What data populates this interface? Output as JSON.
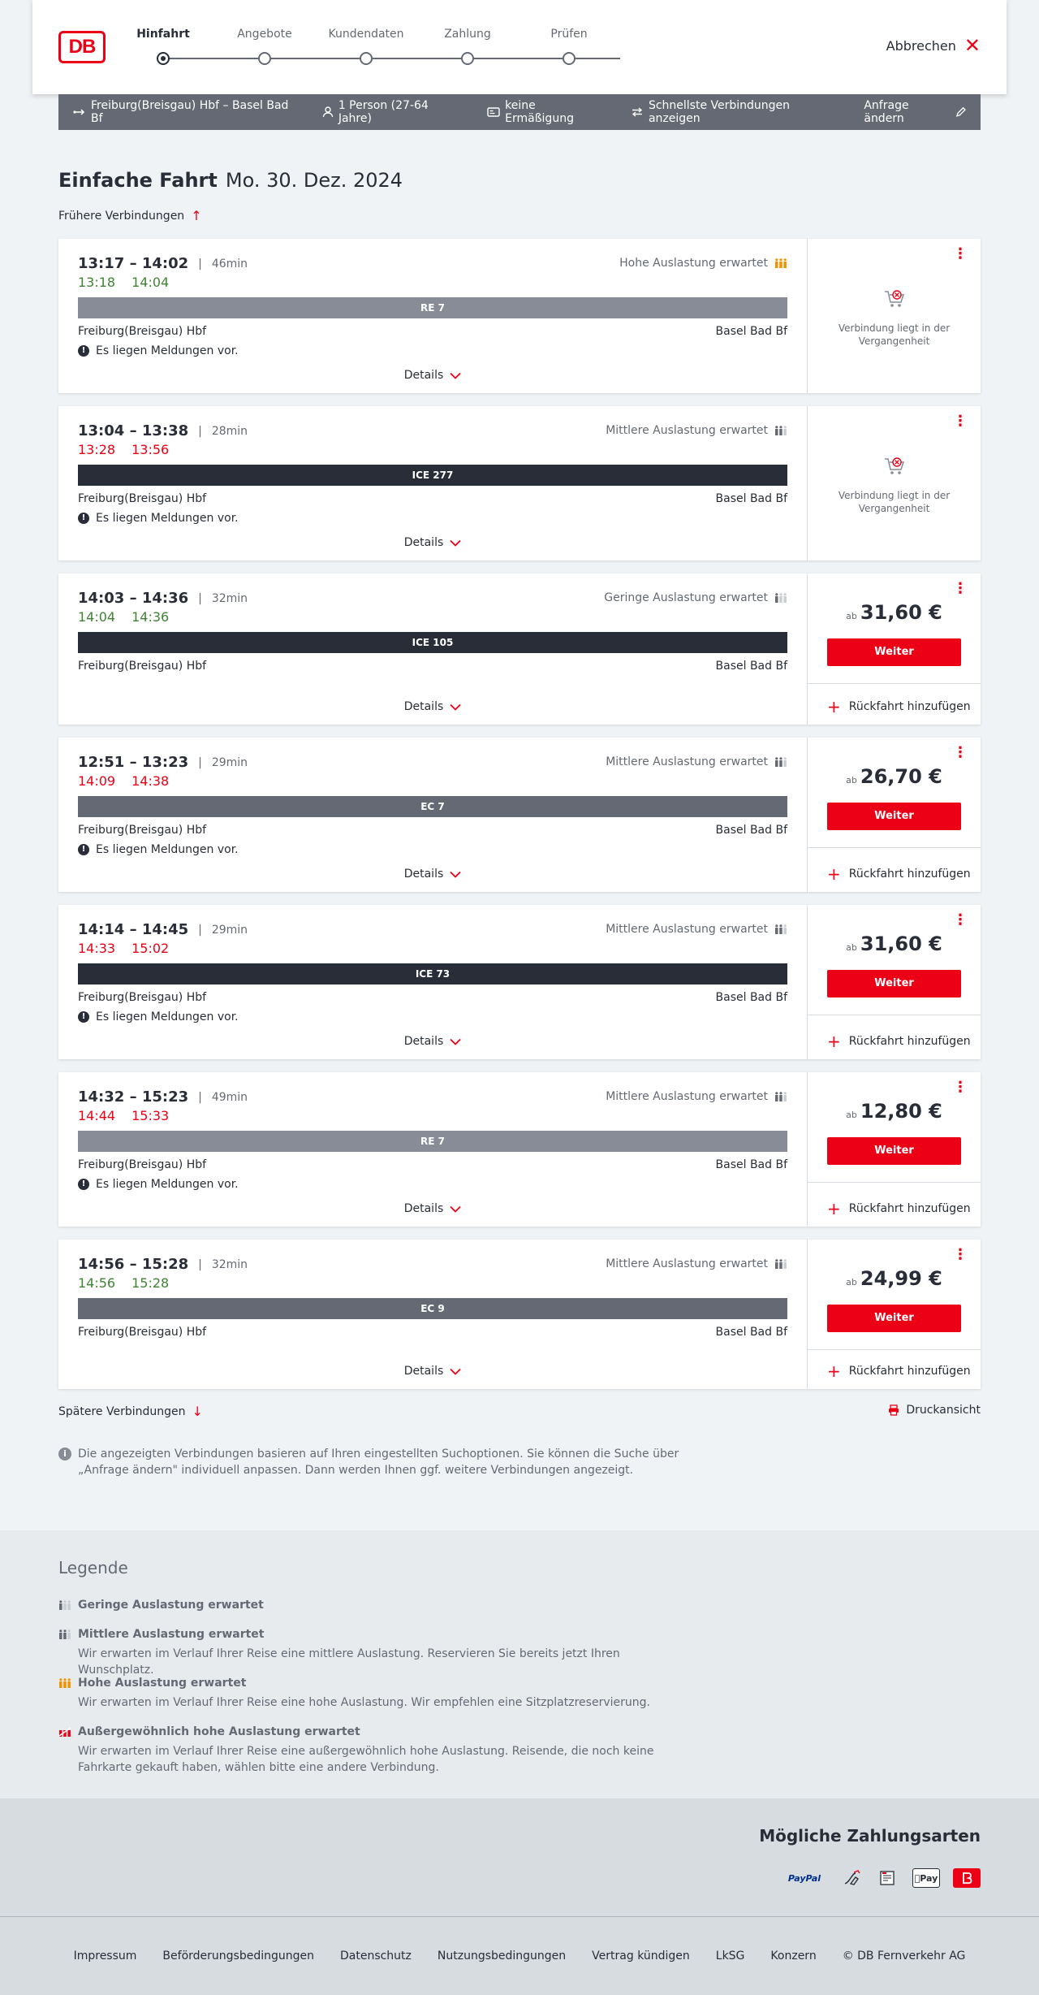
{
  "header": {
    "logo_text": "DB",
    "steps": [
      {
        "label": "Hinfahrt",
        "active": true
      },
      {
        "label": "Angebote",
        "active": false
      },
      {
        "label": "Kundendaten",
        "active": false
      },
      {
        "label": "Zahlung",
        "active": false
      },
      {
        "label": "Prüfen",
        "active": false
      }
    ],
    "cancel_label": "Abbrechen"
  },
  "search": {
    "route": "Freiburg(Breisgau) Hbf – Basel Bad Bf",
    "passengers": "1 Person (27-64 Jahre)",
    "discount": "keine Ermäßigung",
    "fastest": "Schnellste Verbindungen anzeigen",
    "change": "Anfrage ändern"
  },
  "title": {
    "trip_type": "Einfache Fahrt",
    "date": "Mo. 30. Dez. 2024"
  },
  "earlier_label": "Frühere Verbindungen",
  "later_label": "Spätere Verbindungen",
  "print_label": "Druckansicht",
  "connections": [
    {
      "planned": "13:17 – 14:02",
      "duration": "46min",
      "real_dep": "13:18",
      "real_arr": "14:04",
      "delay": false,
      "load": "Hohe Auslastung erwartet",
      "load_level": "high",
      "train": "RE 7",
      "train_type": "re",
      "from": "Freiburg(Breisgau) Hbf",
      "to": "Basel Bad Bf",
      "message": "Es liegen Meldungen vor.",
      "details": "Details",
      "past": true,
      "past_text": "Verbindung liegt in der Vergangenheit"
    },
    {
      "planned": "13:04 – 13:38",
      "duration": "28min",
      "real_dep": "13:28",
      "real_arr": "13:56",
      "delay": true,
      "load": "Mittlere Auslastung erwartet",
      "load_level": "medium",
      "train": "ICE 277",
      "train_type": "ice",
      "from": "Freiburg(Breisgau) Hbf",
      "to": "Basel Bad Bf",
      "message": "Es liegen Meldungen vor.",
      "details": "Details",
      "past": true,
      "past_text": "Verbindung liegt in der Vergangenheit"
    },
    {
      "planned": "14:03 – 14:36",
      "duration": "32min",
      "real_dep": "14:04",
      "real_arr": "14:36",
      "delay": false,
      "load": "Geringe Auslastung erwartet",
      "load_level": "low",
      "train": "ICE 105",
      "train_type": "ice",
      "from": "Freiburg(Breisgau) Hbf",
      "to": "Basel Bad Bf",
      "message": "",
      "details": "Details",
      "past": false,
      "price_prefix": "ab",
      "price": "31,60 €",
      "button": "Weiter",
      "return_label": "Rückfahrt hinzufügen"
    },
    {
      "planned": "12:51 – 13:23",
      "duration": "29min",
      "real_dep": "14:09",
      "real_arr": "14:38",
      "delay": true,
      "load": "Mittlere Auslastung erwartet",
      "load_level": "medium",
      "train": "EC 7",
      "train_type": "ec",
      "from": "Freiburg(Breisgau) Hbf",
      "to": "Basel Bad Bf",
      "message": "Es liegen Meldungen vor.",
      "details": "Details",
      "past": false,
      "price_prefix": "ab",
      "price": "26,70 €",
      "button": "Weiter",
      "return_label": "Rückfahrt hinzufügen"
    },
    {
      "planned": "14:14 – 14:45",
      "duration": "29min",
      "real_dep": "14:33",
      "real_arr": "15:02",
      "delay": true,
      "load": "Mittlere Auslastung erwartet",
      "load_level": "medium",
      "train": "ICE 73",
      "train_type": "ice",
      "from": "Freiburg(Breisgau) Hbf",
      "to": "Basel Bad Bf",
      "message": "Es liegen Meldungen vor.",
      "details": "Details",
      "past": false,
      "price_prefix": "ab",
      "price": "31,60 €",
      "button": "Weiter",
      "return_label": "Rückfahrt hinzufügen"
    },
    {
      "planned": "14:32 – 15:23",
      "duration": "49min",
      "real_dep": "14:44",
      "real_arr": "15:33",
      "delay": true,
      "load": "Mittlere Auslastung erwartet",
      "load_level": "medium",
      "train": "RE 7",
      "train_type": "re",
      "from": "Freiburg(Breisgau) Hbf",
      "to": "Basel Bad Bf",
      "message": "Es liegen Meldungen vor.",
      "details": "Details",
      "past": false,
      "price_prefix": "ab",
      "price": "12,80 €",
      "button": "Weiter",
      "return_label": "Rückfahrt hinzufügen"
    },
    {
      "planned": "14:56 – 15:28",
      "duration": "32min",
      "real_dep": "14:56",
      "real_arr": "15:28",
      "delay": false,
      "load": "Mittlere Auslastung erwartet",
      "load_level": "medium",
      "train": "EC 9",
      "train_type": "ec",
      "from": "Freiburg(Breisgau) Hbf",
      "to": "Basel Bad Bf",
      "message": "",
      "details": "Details",
      "past": false,
      "price_prefix": "ab",
      "price": "24,99 €",
      "button": "Weiter",
      "return_label": "Rückfahrt hinzufügen"
    }
  ],
  "info_text": "Die angezeigten Verbindungen basieren auf Ihren eingestellten Suchoptionen. Sie können die Suche über „Anfrage ändern\" individuell anpassen. Dann werden Ihnen ggf. weitere Verbindungen angezeigt.",
  "legend": {
    "title": "Legende",
    "items": [
      {
        "label": "Geringe Auslastung erwartet",
        "level": "low",
        "desc": ""
      },
      {
        "label": "Mittlere Auslastung erwartet",
        "level": "medium",
        "desc": "Wir erwarten im Verlauf Ihrer Reise eine mittlere Auslastung. Reservieren Sie bereits jetzt Ihren Wunschplatz."
      },
      {
        "label": "Hohe Auslastung erwartet",
        "level": "high",
        "desc": "Wir erwarten im Verlauf Ihrer Reise eine hohe Auslastung. Wir empfehlen eine Sitzplatzreservierung."
      },
      {
        "label": "Außergewöhnlich hohe Auslastung erwartet",
        "level": "extreme",
        "desc": "Wir erwarten im Verlauf Ihrer Reise eine außergewöhnlich hohe Auslastung. Reisende, die noch keine Fahrkarte gekauft haben, wählen bitte eine andere Verbindung."
      }
    ]
  },
  "payment": {
    "title": "Mögliche Zahlungsarten",
    "methods": [
      {
        "name": "PayPal",
        "icon": "paypal-icon"
      },
      {
        "name": "",
        "icon": "sepa-icon"
      },
      {
        "name": "",
        "icon": "invoice-icon"
      },
      {
        "name": "Pay",
        "icon": "applepay-icon"
      },
      {
        "name": "",
        "icon": "db-card-icon"
      }
    ]
  },
  "footer": {
    "links": [
      "Impressum",
      "Beförderungsbedingungen",
      "Datenschutz",
      "Nutzungsbedingungen",
      "Vertrag kündigen",
      "LkSG",
      "Konzern",
      "© DB Fernverkehr AG"
    ]
  },
  "colors": {
    "brand_red": "#ec0016",
    "on_time_green": "#408335",
    "dark": "#282d37",
    "grey": "#646973",
    "load_high_orange": "#f39200"
  }
}
